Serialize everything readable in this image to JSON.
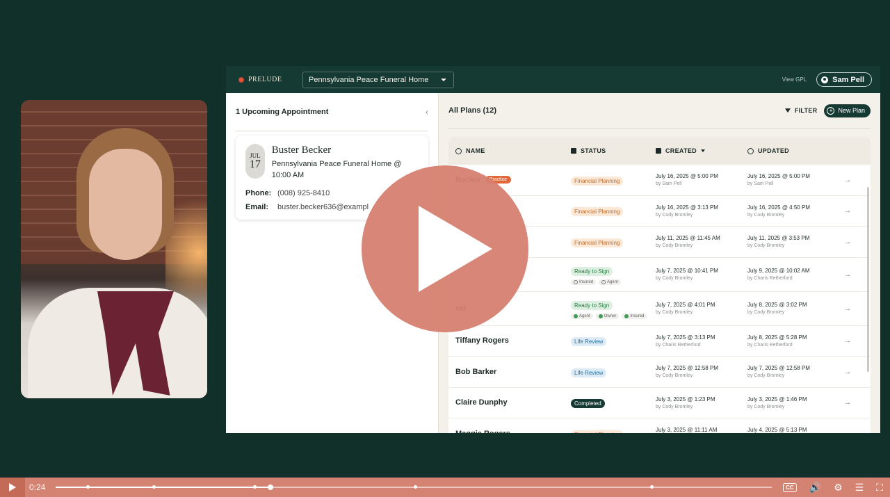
{
  "app": {
    "logo": "PRELUDE",
    "home_select": "Pennsylvania Peace Funeral Home",
    "view_gpl": "View GPL",
    "user": "Sam Pell"
  },
  "appointments": {
    "title": "1 Upcoming Appointment",
    "item": {
      "month": "JUL",
      "day": "17",
      "name": "Buster Becker",
      "location": "Pennsylvania Peace Funeral Home @ 10:00 AM",
      "phone_label": "Phone:",
      "phone": "(008) 925-8410",
      "email_label": "Email:",
      "email": "buster.becker636@exampl"
    }
  },
  "plans": {
    "title": "All Plans (12)",
    "filter_label": "FILTER",
    "new_plan_label": "New Plan",
    "columns": {
      "name": "NAME",
      "status": "STATUS",
      "created": "CREATED",
      "updated": "UPDATED"
    },
    "rows": [
      {
        "name": "Becker",
        "badge": "Practice",
        "status": "Financial Planning",
        "created": "July 16, 2025 @ 5:00 PM",
        "created_by": "by Sam Pell",
        "updated": "July 16, 2025 @ 5:00 PM",
        "updated_by": "by Sam Pell"
      },
      {
        "name": "",
        "status": "Financial Planning",
        "created": "July 16, 2025 @ 3:13 PM",
        "created_by": "by Cody Bromley",
        "updated": "July 16, 2025 @ 4:50 PM",
        "updated_by": "by Cody Bromley"
      },
      {
        "name": "",
        "status": "Financial Planning",
        "created": "July 11, 2025 @ 11:45 AM",
        "created_by": "by Cody Bromley",
        "updated": "July 11, 2025 @ 3:53 PM",
        "updated_by": "by Cody Bromley"
      },
      {
        "name": "",
        "status": "Ready to Sign",
        "tags": [
          "Insured",
          "Agent"
        ],
        "created": "July 7, 2025 @ 10:41 PM",
        "created_by": "by Cody Bromley",
        "updated": "July 9, 2025 @ 10:02 AM",
        "updated_by": "by Charis Retherford"
      },
      {
        "name": "ski",
        "status": "Ready to Sign",
        "tags": [
          "Agent",
          "Owner",
          "Insured"
        ],
        "created": "July 7, 2025 @ 4:01 PM",
        "created_by": "by Cody Bromley",
        "updated": "July 8, 2025 @ 3:02 PM",
        "updated_by": "by Cody Bromley"
      },
      {
        "name": "Tiffany Rogers",
        "status": "Life Review",
        "created": "July 7, 2025 @ 3:13 PM",
        "created_by": "by Charis Retherford",
        "updated": "July 8, 2025 @ 5:28 PM",
        "updated_by": "by Charis Retherford"
      },
      {
        "name": "Bob Barker",
        "status": "Life Review",
        "created": "July 7, 2025 @ 12:58 PM",
        "created_by": "by Cody Bromley",
        "updated": "July 7, 2025 @ 12:58 PM",
        "updated_by": "by Cody Bromley"
      },
      {
        "name": "Claire Dunphy",
        "status": "Completed",
        "created": "July 3, 2025 @ 1:23 PM",
        "created_by": "by Cody Bromley",
        "updated": "July 3, 2025 @ 1:46 PM",
        "updated_by": "by Cody Bromley"
      },
      {
        "name": "Maggie Rogers",
        "status": "Financial Planning",
        "created": "July 3, 2025 @ 11:11 AM",
        "created_by": "by Charis Retherford",
        "updated": "July 4, 2025 @ 5:13 PM",
        "updated_by": "by Cody Bromley"
      }
    ]
  },
  "player": {
    "time": "0:24",
    "progress": 0.3,
    "cc_label": "CC",
    "colors": {
      "bar": "#d48373",
      "play_overlay": "#d68070"
    }
  }
}
